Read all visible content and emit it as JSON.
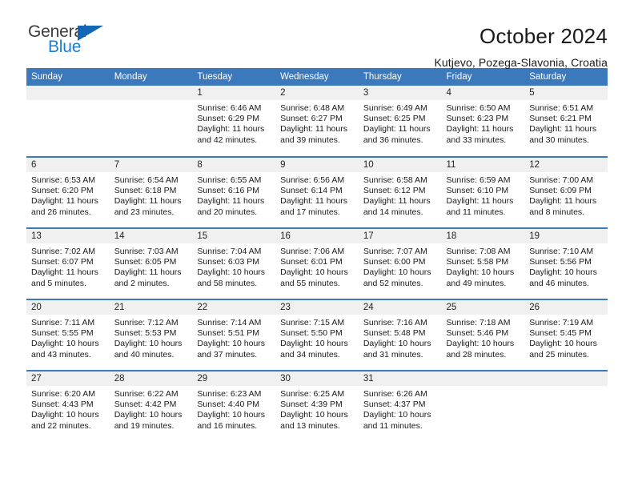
{
  "brand": {
    "word_one": "General",
    "word_two": "Blue",
    "triangle_icon": "triangle-icon",
    "accent_color": "#1567b5",
    "blue_text_color": "#1a7fd4"
  },
  "header": {
    "title": "October 2024",
    "subtitle": "Kutjevo, Pozega-Slavonia, Croatia"
  },
  "calendar": {
    "header_bg": "#3c78bc",
    "daynum_bg": "#f0f0f0",
    "weekday_names": [
      "Sunday",
      "Monday",
      "Tuesday",
      "Wednesday",
      "Thursday",
      "Friday",
      "Saturday"
    ],
    "weeks": [
      [
        {
          "day": "",
          "sunrise": "",
          "sunset": "",
          "daylight": ""
        },
        {
          "day": "",
          "sunrise": "",
          "sunset": "",
          "daylight": ""
        },
        {
          "day": "1",
          "sunrise": "Sunrise: 6:46 AM",
          "sunset": "Sunset: 6:29 PM",
          "daylight": "Daylight: 11 hours and 42 minutes."
        },
        {
          "day": "2",
          "sunrise": "Sunrise: 6:48 AM",
          "sunset": "Sunset: 6:27 PM",
          "daylight": "Daylight: 11 hours and 39 minutes."
        },
        {
          "day": "3",
          "sunrise": "Sunrise: 6:49 AM",
          "sunset": "Sunset: 6:25 PM",
          "daylight": "Daylight: 11 hours and 36 minutes."
        },
        {
          "day": "4",
          "sunrise": "Sunrise: 6:50 AM",
          "sunset": "Sunset: 6:23 PM",
          "daylight": "Daylight: 11 hours and 33 minutes."
        },
        {
          "day": "5",
          "sunrise": "Sunrise: 6:51 AM",
          "sunset": "Sunset: 6:21 PM",
          "daylight": "Daylight: 11 hours and 30 minutes."
        }
      ],
      [
        {
          "day": "6",
          "sunrise": "Sunrise: 6:53 AM",
          "sunset": "Sunset: 6:20 PM",
          "daylight": "Daylight: 11 hours and 26 minutes."
        },
        {
          "day": "7",
          "sunrise": "Sunrise: 6:54 AM",
          "sunset": "Sunset: 6:18 PM",
          "daylight": "Daylight: 11 hours and 23 minutes."
        },
        {
          "day": "8",
          "sunrise": "Sunrise: 6:55 AM",
          "sunset": "Sunset: 6:16 PM",
          "daylight": "Daylight: 11 hours and 20 minutes."
        },
        {
          "day": "9",
          "sunrise": "Sunrise: 6:56 AM",
          "sunset": "Sunset: 6:14 PM",
          "daylight": "Daylight: 11 hours and 17 minutes."
        },
        {
          "day": "10",
          "sunrise": "Sunrise: 6:58 AM",
          "sunset": "Sunset: 6:12 PM",
          "daylight": "Daylight: 11 hours and 14 minutes."
        },
        {
          "day": "11",
          "sunrise": "Sunrise: 6:59 AM",
          "sunset": "Sunset: 6:10 PM",
          "daylight": "Daylight: 11 hours and 11 minutes."
        },
        {
          "day": "12",
          "sunrise": "Sunrise: 7:00 AM",
          "sunset": "Sunset: 6:09 PM",
          "daylight": "Daylight: 11 hours and 8 minutes."
        }
      ],
      [
        {
          "day": "13",
          "sunrise": "Sunrise: 7:02 AM",
          "sunset": "Sunset: 6:07 PM",
          "daylight": "Daylight: 11 hours and 5 minutes."
        },
        {
          "day": "14",
          "sunrise": "Sunrise: 7:03 AM",
          "sunset": "Sunset: 6:05 PM",
          "daylight": "Daylight: 11 hours and 2 minutes."
        },
        {
          "day": "15",
          "sunrise": "Sunrise: 7:04 AM",
          "sunset": "Sunset: 6:03 PM",
          "daylight": "Daylight: 10 hours and 58 minutes."
        },
        {
          "day": "16",
          "sunrise": "Sunrise: 7:06 AM",
          "sunset": "Sunset: 6:01 PM",
          "daylight": "Daylight: 10 hours and 55 minutes."
        },
        {
          "day": "17",
          "sunrise": "Sunrise: 7:07 AM",
          "sunset": "Sunset: 6:00 PM",
          "daylight": "Daylight: 10 hours and 52 minutes."
        },
        {
          "day": "18",
          "sunrise": "Sunrise: 7:08 AM",
          "sunset": "Sunset: 5:58 PM",
          "daylight": "Daylight: 10 hours and 49 minutes."
        },
        {
          "day": "19",
          "sunrise": "Sunrise: 7:10 AM",
          "sunset": "Sunset: 5:56 PM",
          "daylight": "Daylight: 10 hours and 46 minutes."
        }
      ],
      [
        {
          "day": "20",
          "sunrise": "Sunrise: 7:11 AM",
          "sunset": "Sunset: 5:55 PM",
          "daylight": "Daylight: 10 hours and 43 minutes."
        },
        {
          "day": "21",
          "sunrise": "Sunrise: 7:12 AM",
          "sunset": "Sunset: 5:53 PM",
          "daylight": "Daylight: 10 hours and 40 minutes."
        },
        {
          "day": "22",
          "sunrise": "Sunrise: 7:14 AM",
          "sunset": "Sunset: 5:51 PM",
          "daylight": "Daylight: 10 hours and 37 minutes."
        },
        {
          "day": "23",
          "sunrise": "Sunrise: 7:15 AM",
          "sunset": "Sunset: 5:50 PM",
          "daylight": "Daylight: 10 hours and 34 minutes."
        },
        {
          "day": "24",
          "sunrise": "Sunrise: 7:16 AM",
          "sunset": "Sunset: 5:48 PM",
          "daylight": "Daylight: 10 hours and 31 minutes."
        },
        {
          "day": "25",
          "sunrise": "Sunrise: 7:18 AM",
          "sunset": "Sunset: 5:46 PM",
          "daylight": "Daylight: 10 hours and 28 minutes."
        },
        {
          "day": "26",
          "sunrise": "Sunrise: 7:19 AM",
          "sunset": "Sunset: 5:45 PM",
          "daylight": "Daylight: 10 hours and 25 minutes."
        }
      ],
      [
        {
          "day": "27",
          "sunrise": "Sunrise: 6:20 AM",
          "sunset": "Sunset: 4:43 PM",
          "daylight": "Daylight: 10 hours and 22 minutes."
        },
        {
          "day": "28",
          "sunrise": "Sunrise: 6:22 AM",
          "sunset": "Sunset: 4:42 PM",
          "daylight": "Daylight: 10 hours and 19 minutes."
        },
        {
          "day": "29",
          "sunrise": "Sunrise: 6:23 AM",
          "sunset": "Sunset: 4:40 PM",
          "daylight": "Daylight: 10 hours and 16 minutes."
        },
        {
          "day": "30",
          "sunrise": "Sunrise: 6:25 AM",
          "sunset": "Sunset: 4:39 PM",
          "daylight": "Daylight: 10 hours and 13 minutes."
        },
        {
          "day": "31",
          "sunrise": "Sunrise: 6:26 AM",
          "sunset": "Sunset: 4:37 PM",
          "daylight": "Daylight: 10 hours and 11 minutes."
        },
        {
          "day": "",
          "sunrise": "",
          "sunset": "",
          "daylight": ""
        },
        {
          "day": "",
          "sunrise": "",
          "sunset": "",
          "daylight": ""
        }
      ]
    ]
  }
}
